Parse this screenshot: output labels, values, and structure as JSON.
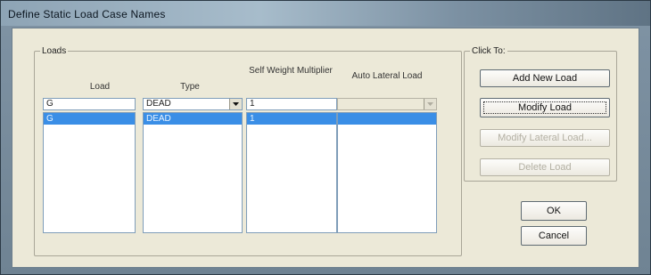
{
  "window": {
    "title": "Define Static Load Case Names"
  },
  "loads_group": {
    "legend": "Loads",
    "columns": {
      "load": "Load",
      "type": "Type",
      "self_weight": "Self Weight Multiplier",
      "auto_lateral": "Auto Lateral Load"
    },
    "edit_row": {
      "load": "G",
      "type": "DEAD",
      "self_weight": "1",
      "auto_lateral": ""
    },
    "rows": [
      {
        "load": "G",
        "type": "DEAD",
        "self_weight": "1",
        "auto_lateral": ""
      }
    ]
  },
  "click_group": {
    "legend": "Click To:",
    "add_new_load": "Add New Load",
    "modify_load": "Modify Load",
    "modify_lateral_load": "Modify Lateral Load...",
    "delete_load": "Delete Load"
  },
  "buttons": {
    "ok": "OK",
    "cancel": "Cancel"
  }
}
